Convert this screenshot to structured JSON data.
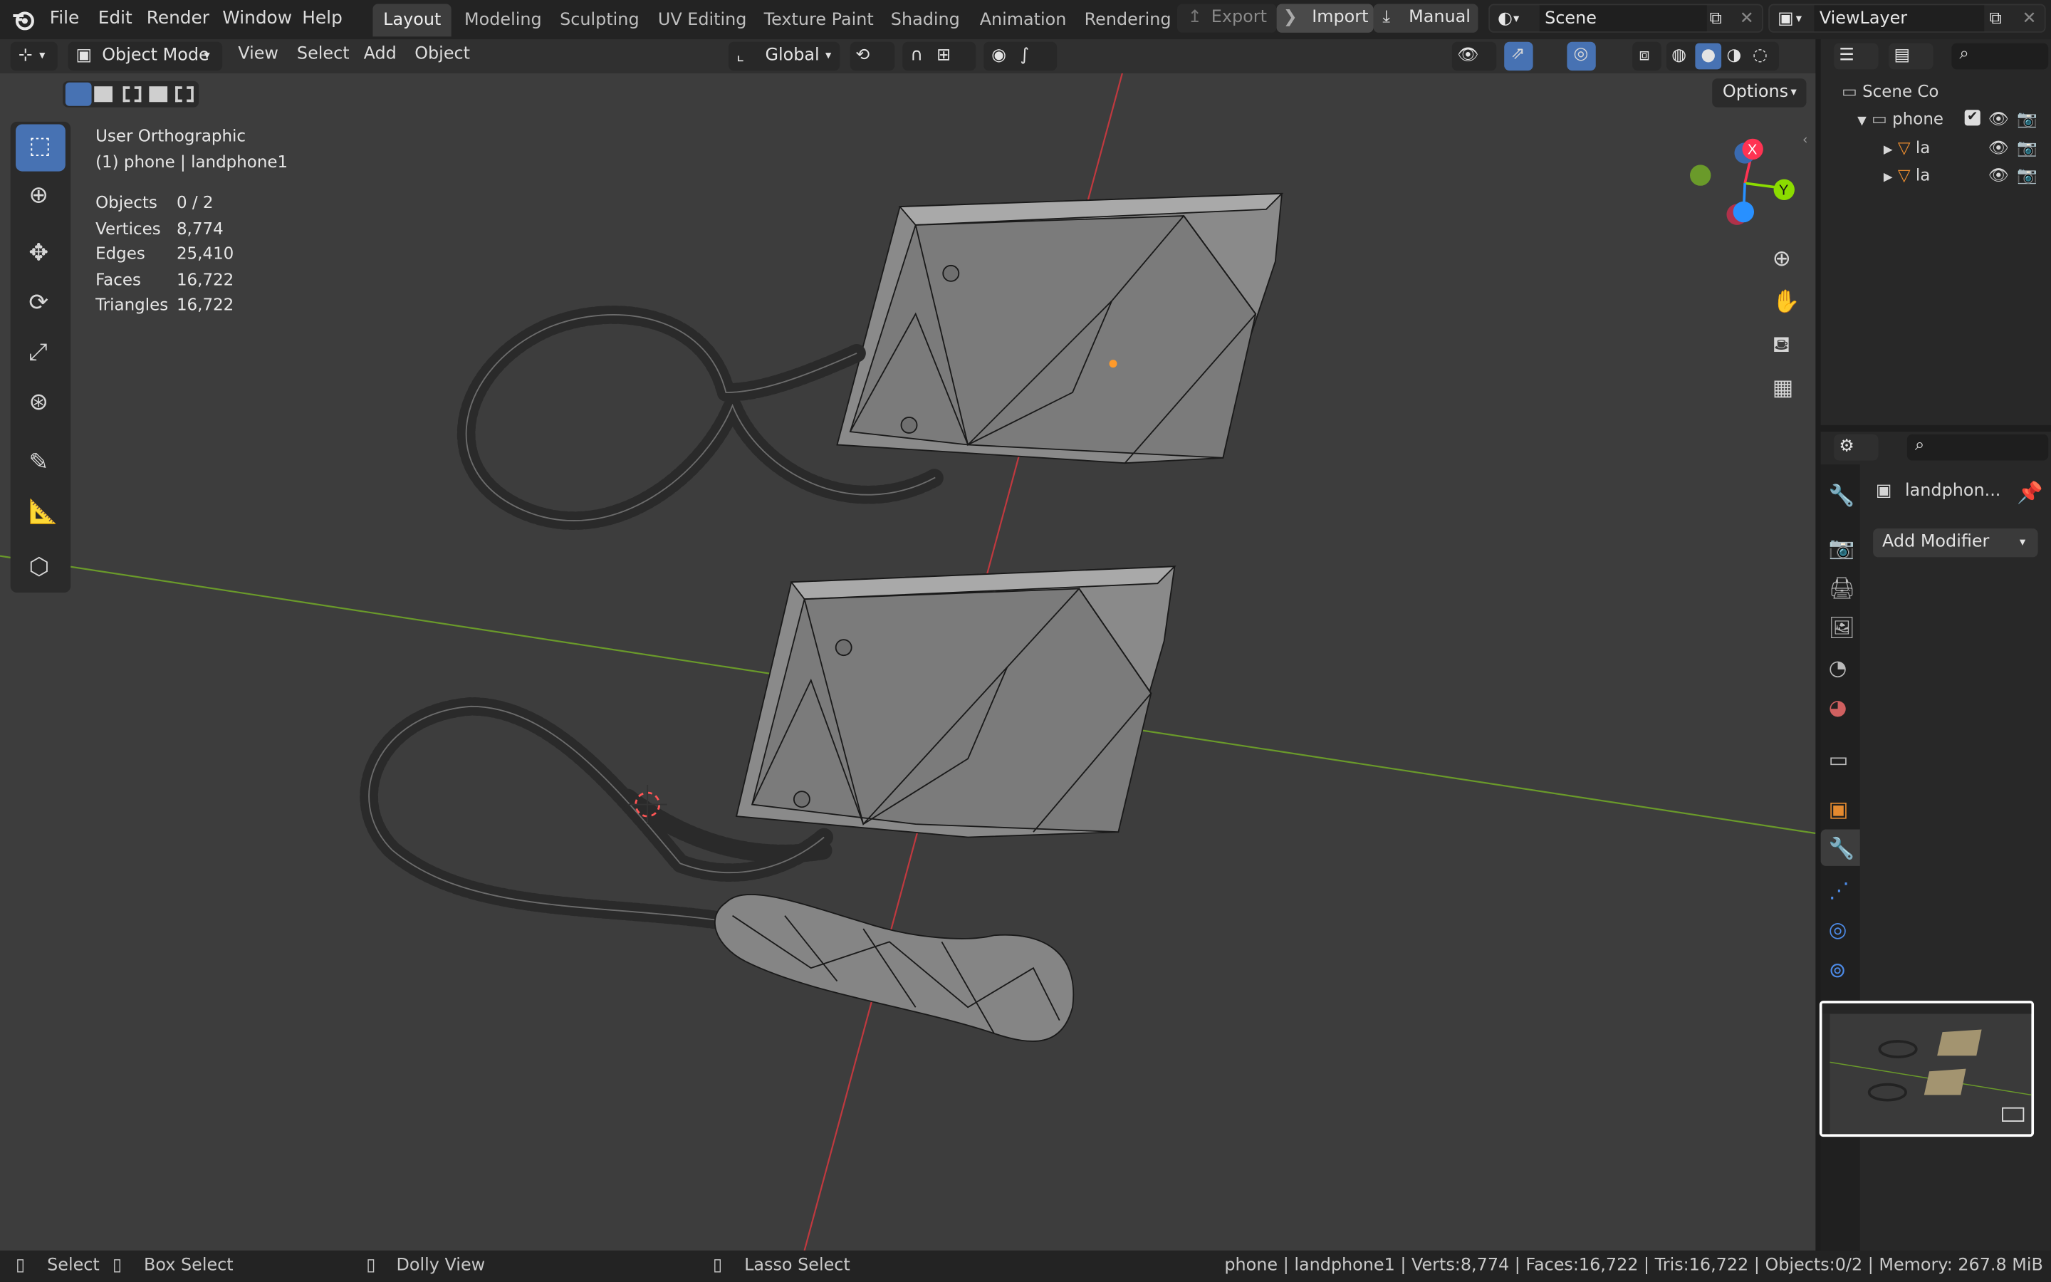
{
  "menu": [
    "File",
    "Edit",
    "Render",
    "Window",
    "Help"
  ],
  "workspaces": [
    {
      "label": "Layout",
      "active": true
    },
    {
      "label": "Modeling"
    },
    {
      "label": "Sculpting"
    },
    {
      "label": "UV Editing"
    },
    {
      "label": "Texture Paint"
    },
    {
      "label": "Shading"
    },
    {
      "label": "Animation"
    },
    {
      "label": "Rendering"
    }
  ],
  "topright": {
    "export": "Export",
    "import": "Import",
    "manual": "Manual",
    "scene": "Scene",
    "viewlayer": "ViewLayer"
  },
  "header3d": {
    "mode": "Object Mode",
    "menus": [
      "View",
      "Select",
      "Add",
      "Object"
    ],
    "orientation": "Global",
    "options": "Options"
  },
  "overlay": {
    "view_name": "User Orthographic",
    "context": "(1) phone | landphone1"
  },
  "stats": [
    {
      "label": "Objects",
      "value": "0 / 2"
    },
    {
      "label": "Vertices",
      "value": "8,774"
    },
    {
      "label": "Edges",
      "value": "25,410"
    },
    {
      "label": "Faces",
      "value": "16,722"
    },
    {
      "label": "Triangles",
      "value": "16,722"
    }
  ],
  "gizmo": {
    "x": "X",
    "y": "Y"
  },
  "outliner": {
    "root": "Scene Co",
    "collection": "phone",
    "items": [
      "la",
      "la"
    ]
  },
  "properties": {
    "object": "landphon...",
    "add_modifier": "Add Modifier"
  },
  "statusbar": {
    "select": "Select",
    "box_select": "Box Select",
    "dolly": "Dolly View",
    "lasso": "Lasso Select",
    "info": "phone | landphone1 | Verts:8,774 | Faces:16,722 | Tris:16,722 | Objects:0/2 | Memory: 267.8 MiB"
  },
  "colors": {
    "accent": "#4772b3",
    "x_axis": "#ff3352",
    "y_axis": "#8bdc00",
    "z_axis": "#2890ff",
    "grid_green": "#6a9a2a",
    "grid_red": "#c0393f"
  }
}
